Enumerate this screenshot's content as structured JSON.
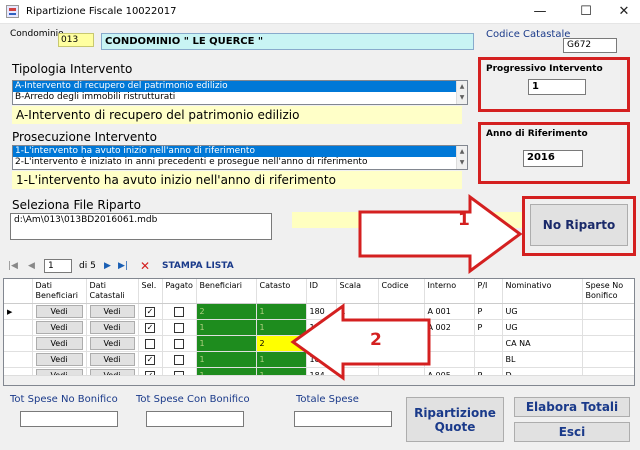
{
  "window": {
    "title": "Ripartizione Fiscale  10022017",
    "minimize": "—",
    "maximize": "☐",
    "close": "✕"
  },
  "condominio": {
    "label": "Condominio",
    "code": "013",
    "name": "CONDOMINIO \" LE QUERCE \""
  },
  "codice_catastale": {
    "label": "Codice Catastale",
    "value": "G672"
  },
  "tipologia": {
    "title": "Tipologia Intervento",
    "items": [
      "A-Intervento di recupero del patrimonio edilizio",
      "B-Arredo degli immobili ristrutturati"
    ],
    "selected_text": "A-Intervento di recupero del patrimonio edilizio"
  },
  "progressivo": {
    "label": "Progressivo Intervento",
    "value": "1"
  },
  "anno": {
    "label": "Anno di Riferimento",
    "value": "2016"
  },
  "prosecuzione": {
    "title": "Prosecuzione Intervento",
    "items": [
      "1-L'intervento ha avuto inizio nell'anno di riferimento",
      "2-L'intervento è iniziato in anni precedenti e prosegue nell'anno di riferimento"
    ],
    "selected_text": "1-L'intervento ha avuto inizio nell'anno di riferimento"
  },
  "file": {
    "title": "Seleziona File Riparto",
    "path": "d:\\Am\\013\\013BD2016061.mdb"
  },
  "no_riparto_button": "No Riparto",
  "annotations": {
    "arrow1": "1",
    "arrow2": "2"
  },
  "navigator": {
    "position": "1",
    "of": "di 5",
    "first": "|◀",
    "prev": "◀",
    "next": "▶",
    "last": "▶|",
    "delete": "✕",
    "print": "STAMPA LISTA"
  },
  "grid": {
    "columns": [
      "Dati Beneficiari",
      "Dati Catastali",
      "Sel.",
      "Pagato",
      "Beneficiari",
      "Catasto",
      "ID",
      "Scala",
      "Codice",
      "Interno",
      "P/I",
      "Nominativo",
      "Spese No Bonifico"
    ],
    "rows": [
      {
        "current": true,
        "b1": "Vedi",
        "b2": "Vedi",
        "sel": true,
        "pagato": false,
        "beneficiari": "2",
        "catasto": "1",
        "id": "180",
        "scala": "A",
        "codice": "",
        "interno": "A 001",
        "pi": "P",
        "nominativo": "UG"
      },
      {
        "current": false,
        "b1": "Vedi",
        "b2": "Vedi",
        "sel": true,
        "pagato": false,
        "beneficiari": "1",
        "catasto": "1",
        "id": "181",
        "scala": "A",
        "codice": "",
        "interno": "A 002",
        "pi": "P",
        "nominativo": "UG"
      },
      {
        "current": false,
        "b1": "Vedi",
        "b2": "Vedi",
        "sel": false,
        "pagato": false,
        "beneficiari": "1",
        "catasto": "2",
        "id": "",
        "scala": "",
        "codice": "",
        "interno": "",
        "pi": "",
        "nominativo": "CA                NA"
      },
      {
        "current": false,
        "b1": "Vedi",
        "b2": "Vedi",
        "sel": true,
        "pagato": false,
        "beneficiari": "1",
        "catasto": "1",
        "id": "183",
        "scala": "",
        "codice": "",
        "interno": "",
        "pi": "",
        "nominativo": "BL"
      },
      {
        "current": false,
        "b1": "Vedi",
        "b2": "Vedi",
        "sel": true,
        "pagato": false,
        "beneficiari": "1",
        "catasto": "1",
        "id": "184",
        "scala": "A",
        "codice": "",
        "interno": "A 005",
        "pi": "P",
        "nominativo": "D..."
      }
    ]
  },
  "totals": {
    "no_bonifico": "Tot Spese No Bonifico",
    "con_bonifico": "Tot Spese Con Bonifico",
    "totale": "Totale Spese"
  },
  "buttons": {
    "ripartizione": "Ripartizione Quote",
    "elabora": "Elabora Totali",
    "esci": "Esci"
  }
}
